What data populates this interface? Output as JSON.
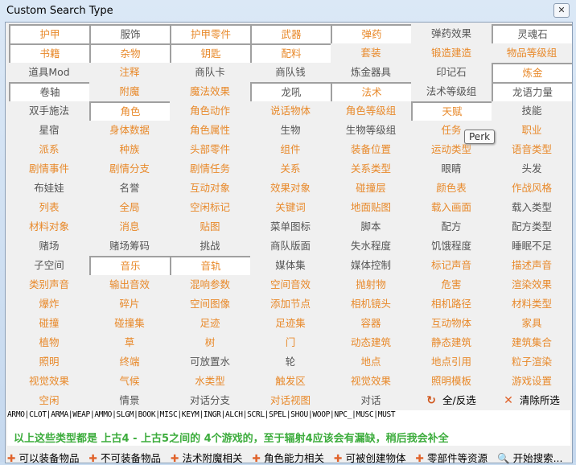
{
  "window": {
    "title": "Custom Search Type",
    "close": "✕"
  },
  "grid": [
    [
      {
        "t": "护甲",
        "c": "o",
        "s": 1
      },
      {
        "t": "服饰",
        "c": "g",
        "s": 1
      },
      {
        "t": "护甲零件",
        "c": "o",
        "s": 1
      },
      {
        "t": "武器",
        "c": "o",
        "s": 1
      },
      {
        "t": "弹药",
        "c": "o",
        "s": 1
      },
      {
        "t": "弹药效果",
        "c": "g",
        "s": 0
      },
      {
        "t": "灵魂石",
        "c": "g",
        "s": 1
      }
    ],
    [
      {
        "t": "书籍",
        "c": "o",
        "s": 1
      },
      {
        "t": "杂物",
        "c": "o",
        "s": 1
      },
      {
        "t": "钥匙",
        "c": "o",
        "s": 1
      },
      {
        "t": "配料",
        "c": "o",
        "s": 1
      },
      {
        "t": "套装",
        "c": "o",
        "s": 0
      },
      {
        "t": "锻造建造",
        "c": "o",
        "s": 0
      },
      {
        "t": "物品等级组",
        "c": "o",
        "s": 0
      }
    ],
    [
      {
        "t": "道具Mod",
        "c": "g",
        "s": 0
      },
      {
        "t": "注释",
        "c": "o",
        "s": 0
      },
      {
        "t": "商队卡",
        "c": "g",
        "s": 0
      },
      {
        "t": "商队钱",
        "c": "g",
        "s": 0
      },
      {
        "t": "炼金器具",
        "c": "g",
        "s": 0
      },
      {
        "t": "印记石",
        "c": "g",
        "s": 0
      },
      {
        "t": "炼金",
        "c": "o",
        "s": 1
      }
    ],
    [
      {
        "t": "卷轴",
        "c": "g",
        "s": 1
      },
      {
        "t": "附魔",
        "c": "o",
        "s": 0
      },
      {
        "t": "魔法效果",
        "c": "o",
        "s": 0
      },
      {
        "t": "龙吼",
        "c": "g",
        "s": 1
      },
      {
        "t": "法术",
        "c": "o",
        "s": 1
      },
      {
        "t": "法术等级组",
        "c": "g",
        "s": 0
      },
      {
        "t": "龙语力量",
        "c": "g",
        "s": 1
      }
    ],
    [
      {
        "t": "双手施法",
        "c": "g",
        "s": 0
      },
      {
        "t": "角色",
        "c": "o",
        "s": 1
      },
      {
        "t": "角色动作",
        "c": "o",
        "s": 0
      },
      {
        "t": "说话物体",
        "c": "o",
        "s": 0
      },
      {
        "t": "角色等级组",
        "c": "o",
        "s": 0
      },
      {
        "t": "天赋",
        "c": "o",
        "s": 1
      },
      {
        "t": "技能",
        "c": "g",
        "s": 0
      }
    ],
    [
      {
        "t": "星宿",
        "c": "g",
        "s": 0
      },
      {
        "t": "身体数据",
        "c": "o",
        "s": 0
      },
      {
        "t": "角色属性",
        "c": "o",
        "s": 0
      },
      {
        "t": "生物",
        "c": "g",
        "s": 0
      },
      {
        "t": "生物等级组",
        "c": "g",
        "s": 0
      },
      {
        "t": "任务",
        "c": "o",
        "s": 0
      },
      {
        "t": "职业",
        "c": "o",
        "s": 0
      }
    ],
    [
      {
        "t": "派系",
        "c": "o",
        "s": 0
      },
      {
        "t": "种族",
        "c": "o",
        "s": 0
      },
      {
        "t": "头部零件",
        "c": "o",
        "s": 0
      },
      {
        "t": "组件",
        "c": "o",
        "s": 0
      },
      {
        "t": "装备位置",
        "c": "o",
        "s": 0
      },
      {
        "t": "运动类型",
        "c": "o",
        "s": 0
      },
      {
        "t": "语音类型",
        "c": "o",
        "s": 0
      }
    ],
    [
      {
        "t": "剧情事件",
        "c": "o",
        "s": 0
      },
      {
        "t": "剧情分支",
        "c": "o",
        "s": 0
      },
      {
        "t": "剧情任务",
        "c": "o",
        "s": 0
      },
      {
        "t": "关系",
        "c": "o",
        "s": 0
      },
      {
        "t": "关系类型",
        "c": "o",
        "s": 0
      },
      {
        "t": "眼睛",
        "c": "g",
        "s": 0
      },
      {
        "t": "头发",
        "c": "g",
        "s": 0
      }
    ],
    [
      {
        "t": "布娃娃",
        "c": "g",
        "s": 0
      },
      {
        "t": "名誉",
        "c": "g",
        "s": 0
      },
      {
        "t": "互动对象",
        "c": "o",
        "s": 0
      },
      {
        "t": "效果对象",
        "c": "o",
        "s": 0
      },
      {
        "t": "碰撞层",
        "c": "o",
        "s": 0
      },
      {
        "t": "颜色表",
        "c": "o",
        "s": 0
      },
      {
        "t": "作战风格",
        "c": "o",
        "s": 0
      }
    ],
    [
      {
        "t": "列表",
        "c": "o",
        "s": 0
      },
      {
        "t": "全局",
        "c": "o",
        "s": 0
      },
      {
        "t": "空闲标记",
        "c": "o",
        "s": 0
      },
      {
        "t": "关键词",
        "c": "o",
        "s": 0
      },
      {
        "t": "地面贴图",
        "c": "o",
        "s": 0
      },
      {
        "t": "载入画面",
        "c": "o",
        "s": 0
      },
      {
        "t": "载入类型",
        "c": "g",
        "s": 0
      }
    ],
    [
      {
        "t": "材料对象",
        "c": "o",
        "s": 0
      },
      {
        "t": "消息",
        "c": "o",
        "s": 0
      },
      {
        "t": "贴图",
        "c": "o",
        "s": 0
      },
      {
        "t": "菜单图标",
        "c": "g",
        "s": 0
      },
      {
        "t": "脚本",
        "c": "g",
        "s": 0
      },
      {
        "t": "配方",
        "c": "g",
        "s": 0
      },
      {
        "t": "配方类型",
        "c": "g",
        "s": 0
      }
    ],
    [
      {
        "t": "赌场",
        "c": "g",
        "s": 0
      },
      {
        "t": "赌场筹码",
        "c": "g",
        "s": 0
      },
      {
        "t": "挑战",
        "c": "g",
        "s": 0
      },
      {
        "t": "商队版面",
        "c": "g",
        "s": 0
      },
      {
        "t": "失水程度",
        "c": "g",
        "s": 0
      },
      {
        "t": "饥饿程度",
        "c": "g",
        "s": 0
      },
      {
        "t": "睡眠不足",
        "c": "g",
        "s": 0
      }
    ],
    [
      {
        "t": "子空间",
        "c": "g",
        "s": 0
      },
      {
        "t": "音乐",
        "c": "o",
        "s": 1
      },
      {
        "t": "音轨",
        "c": "o",
        "s": 1
      },
      {
        "t": "媒体集",
        "c": "g",
        "s": 0
      },
      {
        "t": "媒体控制",
        "c": "g",
        "s": 0
      },
      {
        "t": "标记声音",
        "c": "o",
        "s": 0
      },
      {
        "t": "描述声音",
        "c": "o",
        "s": 0
      }
    ],
    [
      {
        "t": "类别声音",
        "c": "o",
        "s": 0
      },
      {
        "t": "输出音效",
        "c": "o",
        "s": 0
      },
      {
        "t": "混响参数",
        "c": "o",
        "s": 0
      },
      {
        "t": "空间音效",
        "c": "o",
        "s": 0
      },
      {
        "t": "抛射物",
        "c": "o",
        "s": 0
      },
      {
        "t": "危害",
        "c": "o",
        "s": 0
      },
      {
        "t": "渲染效果",
        "c": "o",
        "s": 0
      }
    ],
    [
      {
        "t": "爆炸",
        "c": "o",
        "s": 0
      },
      {
        "t": "碎片",
        "c": "o",
        "s": 0
      },
      {
        "t": "空间图像",
        "c": "o",
        "s": 0
      },
      {
        "t": "添加节点",
        "c": "o",
        "s": 0
      },
      {
        "t": "相机镜头",
        "c": "o",
        "s": 0
      },
      {
        "t": "相机路径",
        "c": "o",
        "s": 0
      },
      {
        "t": "材料类型",
        "c": "o",
        "s": 0
      }
    ],
    [
      {
        "t": "碰撞",
        "c": "o",
        "s": 0
      },
      {
        "t": "碰撞集",
        "c": "o",
        "s": 0
      },
      {
        "t": "足迹",
        "c": "o",
        "s": 0
      },
      {
        "t": "足迹集",
        "c": "o",
        "s": 0
      },
      {
        "t": "容器",
        "c": "o",
        "s": 0
      },
      {
        "t": "互动物体",
        "c": "o",
        "s": 0
      },
      {
        "t": "家具",
        "c": "o",
        "s": 0
      }
    ],
    [
      {
        "t": "植物",
        "c": "o",
        "s": 0
      },
      {
        "t": "草",
        "c": "o",
        "s": 0
      },
      {
        "t": "树",
        "c": "o",
        "s": 0
      },
      {
        "t": "门",
        "c": "o",
        "s": 0
      },
      {
        "t": "动态建筑",
        "c": "o",
        "s": 0
      },
      {
        "t": "静态建筑",
        "c": "o",
        "s": 0
      },
      {
        "t": "建筑集合",
        "c": "o",
        "s": 0
      }
    ],
    [
      {
        "t": "照明",
        "c": "o",
        "s": 0
      },
      {
        "t": "终端",
        "c": "o",
        "s": 0
      },
      {
        "t": "可放置水",
        "c": "g",
        "s": 0
      },
      {
        "t": "轮",
        "c": "g",
        "s": 0
      },
      {
        "t": "地点",
        "c": "o",
        "s": 0
      },
      {
        "t": "地点引用",
        "c": "o",
        "s": 0
      },
      {
        "t": "粒子渲染",
        "c": "o",
        "s": 0
      }
    ],
    [
      {
        "t": "视觉效果",
        "c": "o",
        "s": 0
      },
      {
        "t": "气候",
        "c": "o",
        "s": 0
      },
      {
        "t": "水类型",
        "c": "o",
        "s": 0
      },
      {
        "t": "触发区",
        "c": "o",
        "s": 0
      },
      {
        "t": "视觉效果",
        "c": "o",
        "s": 0
      },
      {
        "t": "照明模板",
        "c": "o",
        "s": 0
      },
      {
        "t": "游戏设置",
        "c": "o",
        "s": 0
      }
    ],
    [
      {
        "t": "空闲",
        "c": "o",
        "s": 0
      },
      {
        "t": "情景",
        "c": "g",
        "s": 0
      },
      {
        "t": "对话分支",
        "c": "g",
        "s": 0
      },
      {
        "t": "对话视图",
        "c": "o",
        "s": 0
      },
      {
        "t": "对话",
        "c": "g",
        "s": 0
      }
    ]
  ],
  "actions": {
    "toggle_all": "全/反选",
    "clear": "清除所选"
  },
  "tooltip": "Perk",
  "codes": "ARMO|CLOT|ARMA|WEAP|AMMO|SLGM|BOOK|MISC|KEYM|INGR|ALCH|SCRL|SPEL|SHOU|WOOP|NPC_|MUSC|MUST",
  "note": "以上这些类型都是 上古4 - 上古5之间的 4个游戏的，至于辐射4应该会有漏缺，稍后我会补全",
  "toolbar": [
    "可以装备物品",
    "不可装备物品",
    "法术附魔相关",
    "角色能力相关",
    "可被创建物体",
    "零部件等资源",
    "开始搜索..."
  ],
  "colors": {
    "orange": "#e8892a",
    "gray": "#555555",
    "green": "#3cac3c"
  }
}
